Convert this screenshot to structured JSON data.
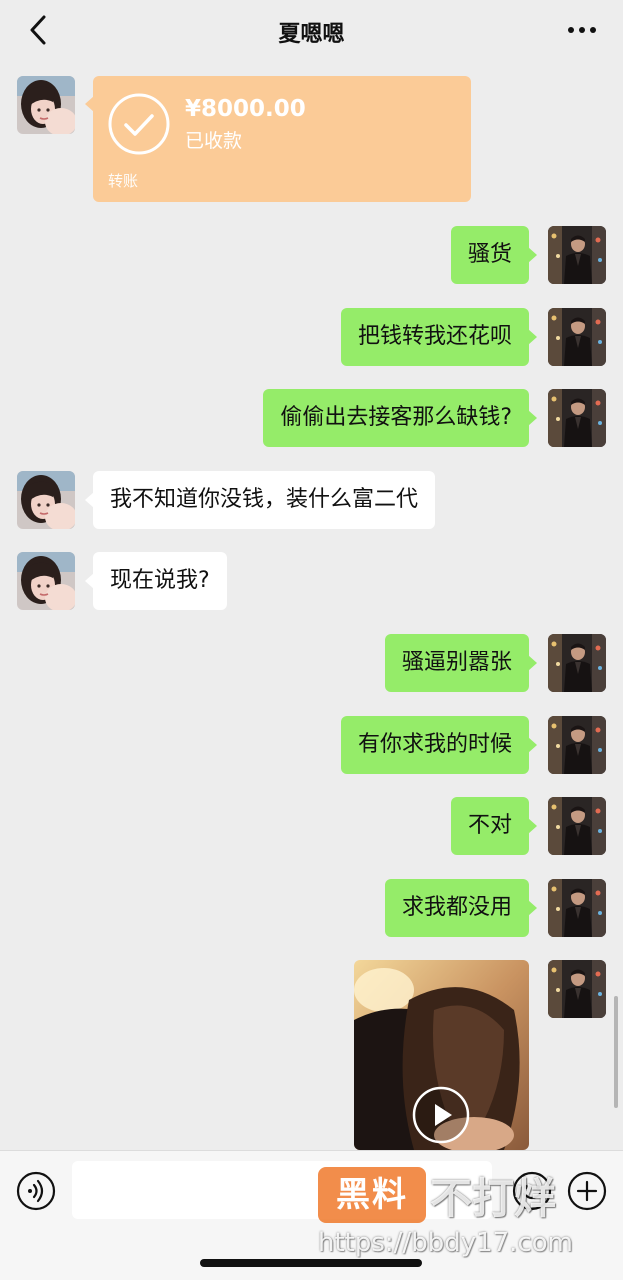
{
  "header": {
    "title": "夏嗯嗯"
  },
  "transfer": {
    "amount": "¥8000.00",
    "status": "已收款",
    "label": "转账"
  },
  "messages": [
    {
      "side": "sent",
      "text": "骚货"
    },
    {
      "side": "sent",
      "text": "把钱转我还花呗"
    },
    {
      "side": "sent",
      "text": "偷偷出去接客那么缺钱?"
    },
    {
      "side": "received",
      "text": "我不知道你没钱，装什么富二代"
    },
    {
      "side": "received",
      "text": "现在说我?"
    },
    {
      "side": "sent",
      "text": "骚逼别嚣张"
    },
    {
      "side": "sent",
      "text": "有你求我的时候"
    },
    {
      "side": "sent",
      "text": "不对"
    },
    {
      "side": "sent",
      "text": "求我都没用"
    }
  ],
  "watermark": {
    "logo": "黑料",
    "text": "不打烊",
    "url": "https://bbdy17.com"
  },
  "colors": {
    "background": "#ededed",
    "sent_bubble": "#95ec69",
    "received_bubble": "#ffffff",
    "transfer_card": "#fbcb97"
  },
  "icons": [
    "back-icon",
    "more-icon",
    "check-icon",
    "play-icon",
    "voice-icon",
    "emoji-icon",
    "plus-icon"
  ]
}
